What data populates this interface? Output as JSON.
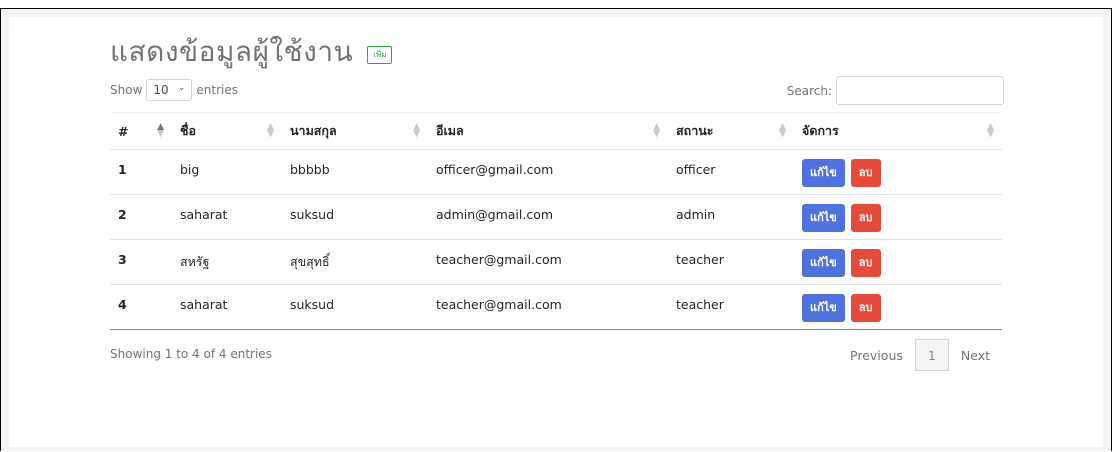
{
  "header": {
    "title": "แสดงข้อมูลผู้ใช้งาน",
    "add_label": "เพิ่ม"
  },
  "length_control": {
    "prefix": "Show",
    "value": "10",
    "suffix": "entries"
  },
  "search": {
    "label": "Search:",
    "value": ""
  },
  "table": {
    "columns": [
      "#",
      "ชื่อ",
      "นามสกุล",
      "อีเมล",
      "สถานะ",
      "จัดการ"
    ],
    "rows": [
      {
        "num": "1",
        "first_name": "big",
        "last_name": "bbbbb",
        "email": "officer@gmail.com",
        "status": "officer"
      },
      {
        "num": "2",
        "first_name": "saharat",
        "last_name": "suksud",
        "email": "admin@gmail.com",
        "status": "admin"
      },
      {
        "num": "3",
        "first_name": "สหรัฐ",
        "last_name": "สุขสุทธิ์",
        "email": "teacher@gmail.com",
        "status": "teacher"
      },
      {
        "num": "4",
        "first_name": "saharat",
        "last_name": "suksud",
        "email": "teacher@gmail.com",
        "status": "teacher"
      }
    ],
    "edit_label": "แก้ไข",
    "delete_label": "ลบ"
  },
  "footer": {
    "info": "Showing 1 to 4 of 4 entries",
    "previous": "Previous",
    "current_page": "1",
    "next": "Next"
  },
  "colors": {
    "edit": "#4e73df",
    "delete": "#e74a3b",
    "add": "#28a745"
  }
}
